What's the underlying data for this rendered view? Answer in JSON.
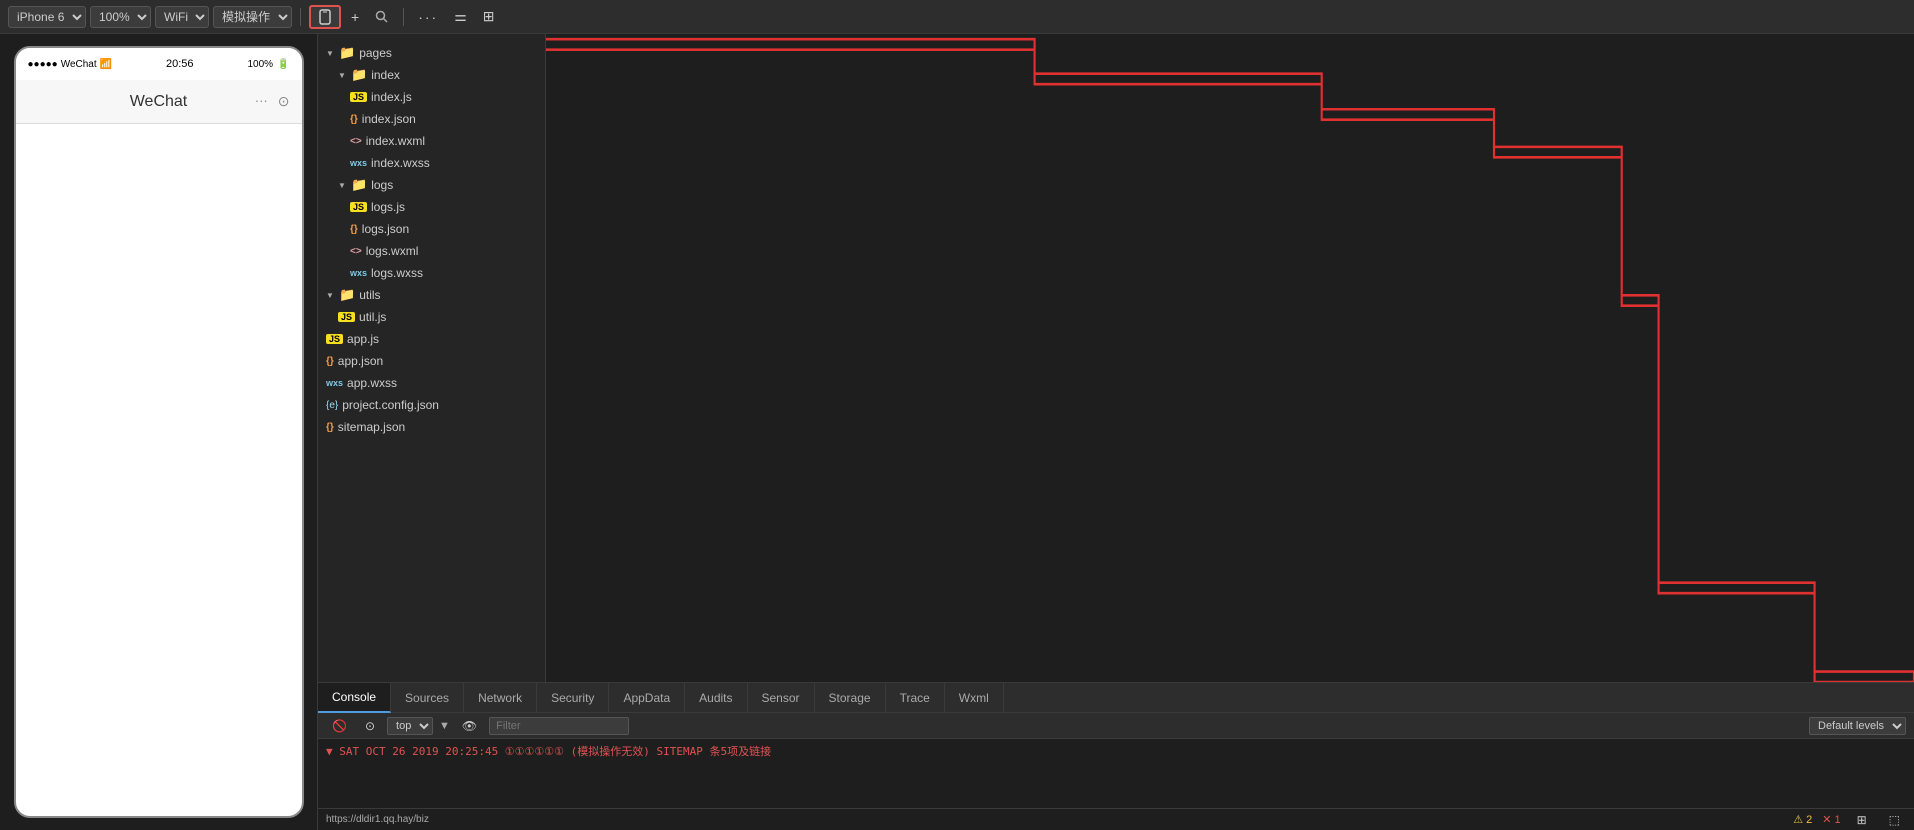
{
  "toolbar": {
    "device_label": "iPhone 6",
    "zoom_label": "100%",
    "network_label": "WiFi",
    "mode_label": "模拟操作",
    "add_label": "+",
    "search_label": "🔍",
    "more_label": "···",
    "layout_label": "⚌",
    "extra_label": "⊞"
  },
  "phone": {
    "signal": "●●●●●",
    "app_name": "WeChat",
    "wifi_icon": "WiFi",
    "time": "20:56",
    "battery": "100%",
    "header_title": "WeChat",
    "more_icon": "···",
    "record_icon": "⊙"
  },
  "file_tree": {
    "items": [
      {
        "indent": 1,
        "type": "folder",
        "arrow": "▼",
        "name": "pages"
      },
      {
        "indent": 2,
        "type": "folder",
        "arrow": "▼",
        "name": "index"
      },
      {
        "indent": 3,
        "type": "js",
        "badge": "JS",
        "name": "index.js"
      },
      {
        "indent": 3,
        "type": "json",
        "badge": "{}",
        "name": "index.json"
      },
      {
        "indent": 3,
        "type": "wxml",
        "badge": "<>",
        "name": "index.wxml"
      },
      {
        "indent": 3,
        "type": "wxss",
        "badge": "wxs",
        "name": "index.wxss"
      },
      {
        "indent": 2,
        "type": "folder",
        "arrow": "▼",
        "name": "logs"
      },
      {
        "indent": 3,
        "type": "js",
        "badge": "JS",
        "name": "logs.js"
      },
      {
        "indent": 3,
        "type": "json",
        "badge": "{}",
        "name": "logs.json"
      },
      {
        "indent": 3,
        "type": "wxml",
        "badge": "<>",
        "name": "logs.wxml"
      },
      {
        "indent": 3,
        "type": "wxss",
        "badge": "wxs",
        "name": "logs.wxss"
      },
      {
        "indent": 1,
        "type": "folder",
        "arrow": "▼",
        "name": "utils"
      },
      {
        "indent": 2,
        "type": "js",
        "badge": "JS",
        "name": "util.js"
      },
      {
        "indent": 1,
        "type": "js",
        "badge": "JS",
        "name": "app.js"
      },
      {
        "indent": 1,
        "type": "json",
        "badge": "{}",
        "name": "app.json"
      },
      {
        "indent": 1,
        "type": "wxss",
        "badge": "wxs",
        "name": "app.wxss"
      },
      {
        "indent": 1,
        "type": "config",
        "badge": "{e}",
        "name": "project.config.json"
      },
      {
        "indent": 1,
        "type": "json",
        "badge": "{}",
        "name": "sitemap.json"
      }
    ]
  },
  "bottom_tabs": [
    {
      "label": "Console",
      "active": true
    },
    {
      "label": "Sources",
      "active": false
    },
    {
      "label": "Network",
      "active": false
    },
    {
      "label": "Security",
      "active": false
    },
    {
      "label": "AppData",
      "active": false
    },
    {
      "label": "Audits",
      "active": false
    },
    {
      "label": "Sensor",
      "active": false
    },
    {
      "label": "Storage",
      "active": false
    },
    {
      "label": "Trace",
      "active": false
    },
    {
      "label": "Wxml",
      "active": false
    }
  ],
  "bottom_toolbar": {
    "context_label": "top",
    "filter_placeholder": "Filter",
    "levels_label": "Default levels"
  },
  "console_log": "▼ SAT OCT 26 2019 20:25:45 ①①①①①① (模拟操作无效) SITEMAP 条5项及链接",
  "status_bar": {
    "url": "https://dldir1.qq.hay/biz",
    "warnings": "2",
    "errors": "1",
    "warning_icon": "⚠",
    "error_icon": "✕"
  }
}
